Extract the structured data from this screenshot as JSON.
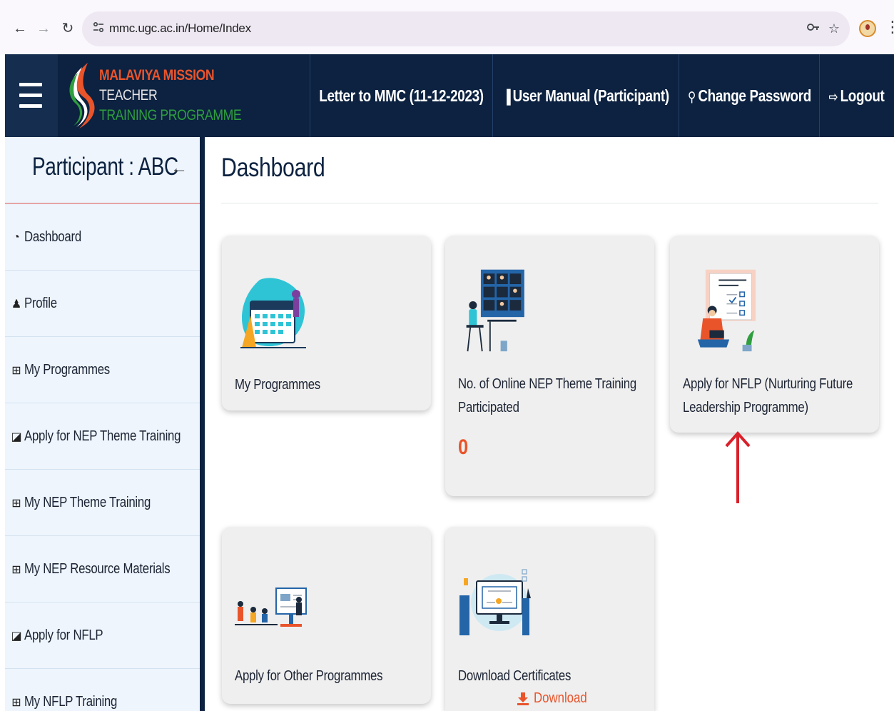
{
  "browser": {
    "url": "mmc.ugc.ac.in/Home/Index"
  },
  "header": {
    "logo": {
      "line1": "MALAVIYA MISSION",
      "line2": "TEACHER",
      "line3": "TRAINING PROGRAMME"
    },
    "nav": [
      {
        "label": "Letter to MMC (11-12-2023)",
        "icon": ""
      },
      {
        "label": "User Manual (Participant)",
        "icon": "book-icon"
      },
      {
        "label": "Change Password",
        "icon": "key-icon"
      },
      {
        "label": "Logout",
        "icon": "logout-icon"
      }
    ]
  },
  "sidebar": {
    "title": "Participant : ABC",
    "items": [
      {
        "label": "Dashboard",
        "icon": "dashboard-icon"
      },
      {
        "label": "Profile",
        "icon": "user-icon"
      },
      {
        "label": "My Programmes",
        "icon": "grid-icon"
      },
      {
        "label": "Apply for NEP Theme Training",
        "icon": "edit-icon"
      },
      {
        "label": "My NEP Theme Training",
        "icon": "grid-icon"
      },
      {
        "label": "My NEP Resource Materials",
        "icon": "grid-icon"
      },
      {
        "label": "Apply for NFLP",
        "icon": "edit-icon"
      },
      {
        "label": "My NFLP Training",
        "icon": "grid-icon"
      }
    ]
  },
  "main": {
    "title": "Dashboard",
    "cards": [
      {
        "label": "My Programmes",
        "icon": "calendar-illustration"
      },
      {
        "label_line1": "No. of Online NEP Theme Training",
        "label_line2": "Participated",
        "count": "0",
        "icon": "video-conference-illustration"
      },
      {
        "label_line1": "Apply for NFLP (Nurturing Future",
        "label_line2": "Leadership Programme)",
        "icon": "checklist-illustration"
      },
      {
        "label": "Apply for Other Programmes",
        "icon": "classroom-illustration"
      },
      {
        "label": "Download Certificates",
        "link": "Download",
        "icon": "certificate-illustration"
      }
    ]
  },
  "colors": {
    "navy": "#0c2240",
    "accent_orange": "#e9542b",
    "annotation_red": "#d9202b",
    "sidebar_bg": "#eef5fd",
    "card_bg": "#efefef"
  }
}
